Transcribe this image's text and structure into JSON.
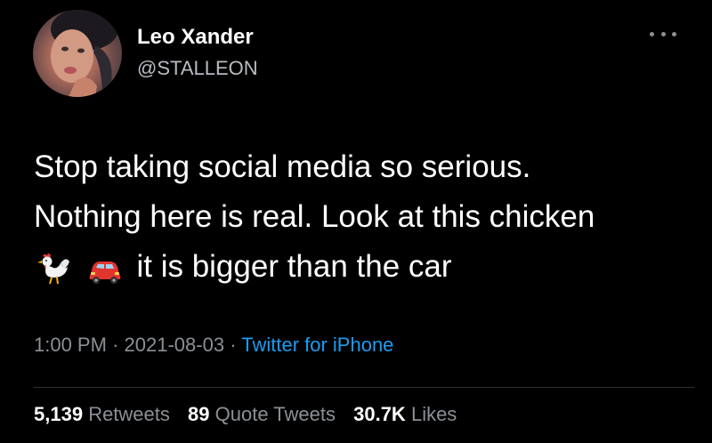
{
  "author": {
    "display_name": "Leo Xander",
    "handle": "@STALLEON",
    "avatar_icon": "avatar-photo"
  },
  "tweet": {
    "line1": "Stop taking social media so serious.",
    "line2": "Nothing here is real. Look at this chicken",
    "line3": "it is bigger than the car",
    "emojis": [
      "rooster-emoji",
      "car-emoji"
    ]
  },
  "meta": {
    "time": "1:00 PM",
    "separator": "·",
    "date": "2021-08-03",
    "source": "Twitter for iPhone"
  },
  "stats": {
    "retweets_count": "5,139",
    "retweets_label": "Retweets",
    "quotes_count": "89",
    "quotes_label": "Quote Tweets",
    "likes_count": "30.7K",
    "likes_label": "Likes"
  },
  "colors": {
    "background": "#000000",
    "text": "#ffffff",
    "secondary": "#8b9095",
    "link": "#1d9bf0"
  }
}
